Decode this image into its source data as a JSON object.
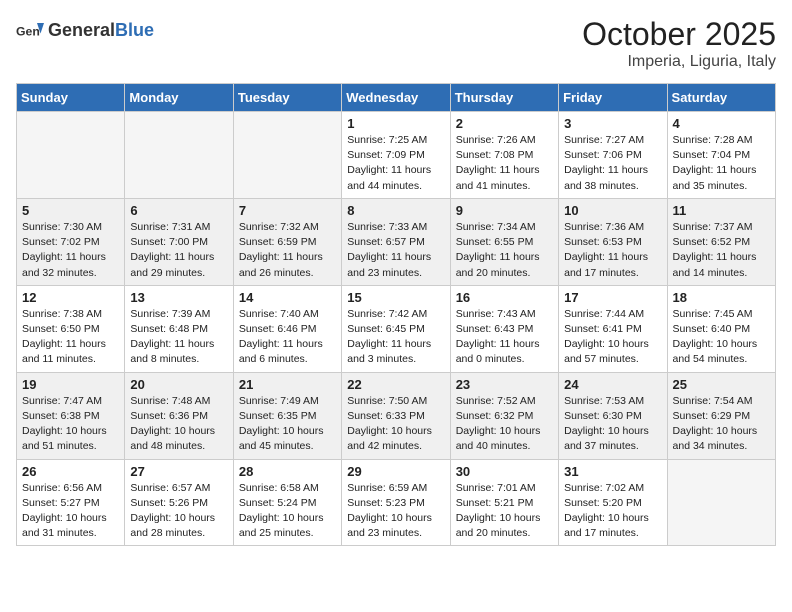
{
  "header": {
    "logo_general": "General",
    "logo_blue": "Blue",
    "month": "October 2025",
    "location": "Imperia, Liguria, Italy"
  },
  "days_of_week": [
    "Sunday",
    "Monday",
    "Tuesday",
    "Wednesday",
    "Thursday",
    "Friday",
    "Saturday"
  ],
  "weeks": [
    [
      {
        "day": "",
        "info": ""
      },
      {
        "day": "",
        "info": ""
      },
      {
        "day": "",
        "info": ""
      },
      {
        "day": "1",
        "info": "Sunrise: 7:25 AM\nSunset: 7:09 PM\nDaylight: 11 hours and 44 minutes."
      },
      {
        "day": "2",
        "info": "Sunrise: 7:26 AM\nSunset: 7:08 PM\nDaylight: 11 hours and 41 minutes."
      },
      {
        "day": "3",
        "info": "Sunrise: 7:27 AM\nSunset: 7:06 PM\nDaylight: 11 hours and 38 minutes."
      },
      {
        "day": "4",
        "info": "Sunrise: 7:28 AM\nSunset: 7:04 PM\nDaylight: 11 hours and 35 minutes."
      }
    ],
    [
      {
        "day": "5",
        "info": "Sunrise: 7:30 AM\nSunset: 7:02 PM\nDaylight: 11 hours and 32 minutes."
      },
      {
        "day": "6",
        "info": "Sunrise: 7:31 AM\nSunset: 7:00 PM\nDaylight: 11 hours and 29 minutes."
      },
      {
        "day": "7",
        "info": "Sunrise: 7:32 AM\nSunset: 6:59 PM\nDaylight: 11 hours and 26 minutes."
      },
      {
        "day": "8",
        "info": "Sunrise: 7:33 AM\nSunset: 6:57 PM\nDaylight: 11 hours and 23 minutes."
      },
      {
        "day": "9",
        "info": "Sunrise: 7:34 AM\nSunset: 6:55 PM\nDaylight: 11 hours and 20 minutes."
      },
      {
        "day": "10",
        "info": "Sunrise: 7:36 AM\nSunset: 6:53 PM\nDaylight: 11 hours and 17 minutes."
      },
      {
        "day": "11",
        "info": "Sunrise: 7:37 AM\nSunset: 6:52 PM\nDaylight: 11 hours and 14 minutes."
      }
    ],
    [
      {
        "day": "12",
        "info": "Sunrise: 7:38 AM\nSunset: 6:50 PM\nDaylight: 11 hours and 11 minutes."
      },
      {
        "day": "13",
        "info": "Sunrise: 7:39 AM\nSunset: 6:48 PM\nDaylight: 11 hours and 8 minutes."
      },
      {
        "day": "14",
        "info": "Sunrise: 7:40 AM\nSunset: 6:46 PM\nDaylight: 11 hours and 6 minutes."
      },
      {
        "day": "15",
        "info": "Sunrise: 7:42 AM\nSunset: 6:45 PM\nDaylight: 11 hours and 3 minutes."
      },
      {
        "day": "16",
        "info": "Sunrise: 7:43 AM\nSunset: 6:43 PM\nDaylight: 11 hours and 0 minutes."
      },
      {
        "day": "17",
        "info": "Sunrise: 7:44 AM\nSunset: 6:41 PM\nDaylight: 10 hours and 57 minutes."
      },
      {
        "day": "18",
        "info": "Sunrise: 7:45 AM\nSunset: 6:40 PM\nDaylight: 10 hours and 54 minutes."
      }
    ],
    [
      {
        "day": "19",
        "info": "Sunrise: 7:47 AM\nSunset: 6:38 PM\nDaylight: 10 hours and 51 minutes."
      },
      {
        "day": "20",
        "info": "Sunrise: 7:48 AM\nSunset: 6:36 PM\nDaylight: 10 hours and 48 minutes."
      },
      {
        "day": "21",
        "info": "Sunrise: 7:49 AM\nSunset: 6:35 PM\nDaylight: 10 hours and 45 minutes."
      },
      {
        "day": "22",
        "info": "Sunrise: 7:50 AM\nSunset: 6:33 PM\nDaylight: 10 hours and 42 minutes."
      },
      {
        "day": "23",
        "info": "Sunrise: 7:52 AM\nSunset: 6:32 PM\nDaylight: 10 hours and 40 minutes."
      },
      {
        "day": "24",
        "info": "Sunrise: 7:53 AM\nSunset: 6:30 PM\nDaylight: 10 hours and 37 minutes."
      },
      {
        "day": "25",
        "info": "Sunrise: 7:54 AM\nSunset: 6:29 PM\nDaylight: 10 hours and 34 minutes."
      }
    ],
    [
      {
        "day": "26",
        "info": "Sunrise: 6:56 AM\nSunset: 5:27 PM\nDaylight: 10 hours and 31 minutes."
      },
      {
        "day": "27",
        "info": "Sunrise: 6:57 AM\nSunset: 5:26 PM\nDaylight: 10 hours and 28 minutes."
      },
      {
        "day": "28",
        "info": "Sunrise: 6:58 AM\nSunset: 5:24 PM\nDaylight: 10 hours and 25 minutes."
      },
      {
        "day": "29",
        "info": "Sunrise: 6:59 AM\nSunset: 5:23 PM\nDaylight: 10 hours and 23 minutes."
      },
      {
        "day": "30",
        "info": "Sunrise: 7:01 AM\nSunset: 5:21 PM\nDaylight: 10 hours and 20 minutes."
      },
      {
        "day": "31",
        "info": "Sunrise: 7:02 AM\nSunset: 5:20 PM\nDaylight: 10 hours and 17 minutes."
      },
      {
        "day": "",
        "info": ""
      }
    ]
  ]
}
